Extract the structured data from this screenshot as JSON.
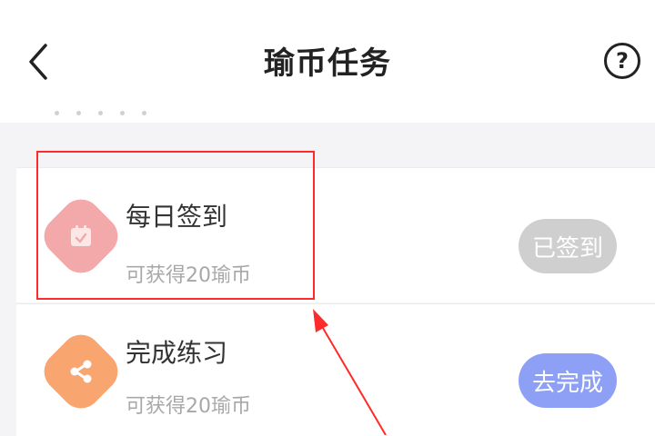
{
  "header": {
    "title": "瑜币任务",
    "back_icon": "chevron-left-icon",
    "help_label": "?"
  },
  "tasks": [
    {
      "name": "每日签到",
      "reward": "可获得20瑜币",
      "button_label": "已签到",
      "icon": "calendar-check-icon",
      "icon_color": "#f3a9aa",
      "button_color": "#cfcfcf"
    },
    {
      "name": "完成练习",
      "reward": "可获得20瑜币",
      "button_label": "去完成",
      "icon": "share-icon",
      "icon_color": "#f8a56f",
      "button_color": "#8ea0f5"
    }
  ],
  "annotation": {
    "highlight_color": "#ff2b2b"
  }
}
